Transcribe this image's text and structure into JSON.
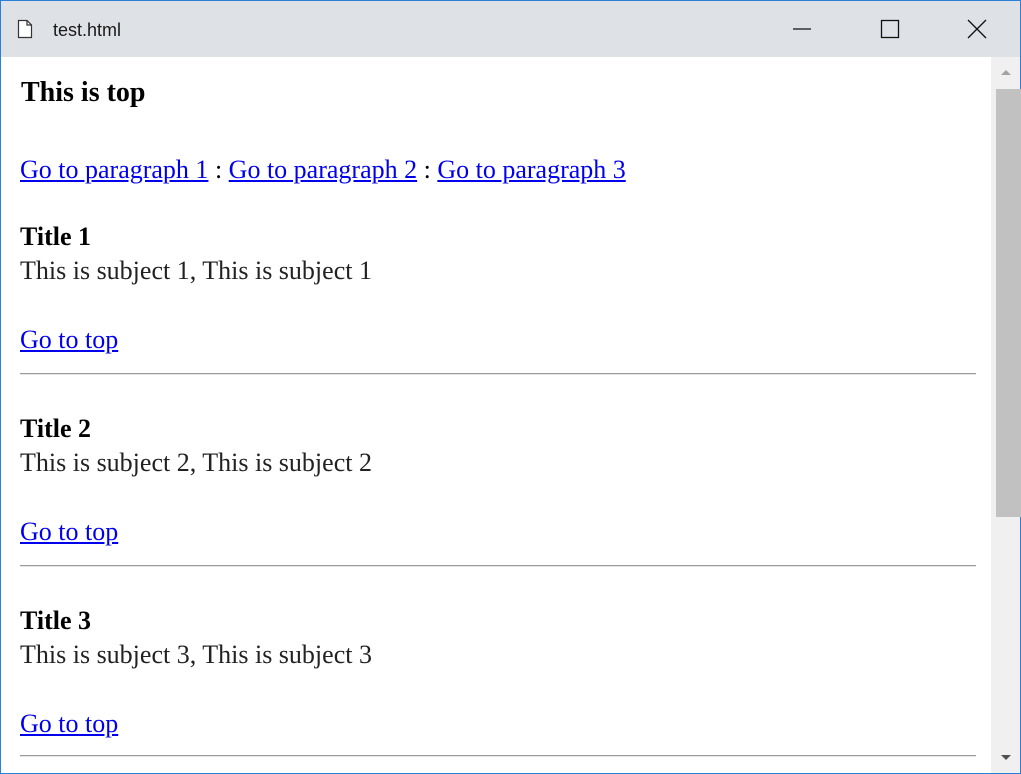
{
  "window": {
    "title": "test.html",
    "icons": {
      "document": "document-icon",
      "minimize": "minimize-icon",
      "maximize": "maximize-icon",
      "close": "close-icon",
      "scroll_up": "scroll-up-arrow-icon",
      "scroll_down": "scroll-down-arrow-icon"
    }
  },
  "page": {
    "heading": "This is top",
    "nav": {
      "links": [
        "Go to paragraph 1",
        "Go to paragraph 2",
        "Go to paragraph 3"
      ],
      "separator": ":"
    },
    "sections": [
      {
        "title": "Title 1",
        "subject": "This is subject 1, This is subject 1",
        "top_link": "Go to top"
      },
      {
        "title": "Title 2",
        "subject": "This is subject 2, This is subject 2",
        "top_link": "Go to top"
      },
      {
        "title": "Title 3",
        "subject": "This is subject 3, This is subject 3",
        "top_link": "Go to top"
      }
    ]
  },
  "colors": {
    "link": "#0000ee",
    "titlebar": "#dee1e6",
    "window_border": "#2b80d6",
    "scroll_thumb": "#c1c1c1"
  }
}
